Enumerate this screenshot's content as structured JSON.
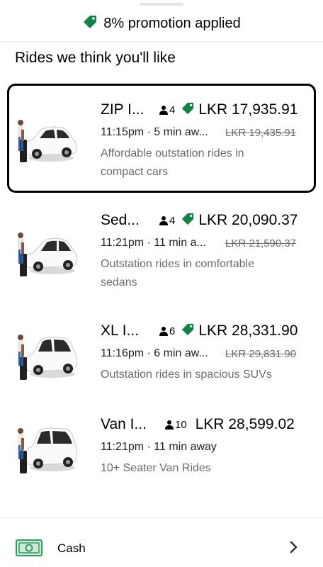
{
  "promo": {
    "text": "8% promotion applied",
    "icon": "tag-icon",
    "color": "#0e8345"
  },
  "section": {
    "title": "Rides we think you'll like"
  },
  "rides": [
    {
      "name": "ZIP I...",
      "capacity": "4",
      "promo_applied": true,
      "price": "LKR 17,935.91",
      "eta": "11:15pm · 5 min aw...",
      "old_price": "LKR 19,435.91",
      "description": "Affordable outstation rides in compact cars",
      "selected": true,
      "vehicle": "compact-car"
    },
    {
      "name": "Sed...",
      "capacity": "4",
      "promo_applied": true,
      "price": "LKR 20,090.37",
      "eta": "11:21pm · 11 min a...",
      "old_price": "LKR 21,590.37",
      "description": "Outstation rides in comfortable sedans",
      "selected": false,
      "vehicle": "sedan"
    },
    {
      "name": "XL I...",
      "capacity": "6",
      "promo_applied": true,
      "price": "LKR 28,331.90",
      "eta": "11:16pm · 6 min aw...",
      "old_price": "LKR 29,831.90",
      "description": "Outstation rides in spacious SUVs",
      "selected": false,
      "vehicle": "suv"
    },
    {
      "name": "Van I...",
      "capacity": "10",
      "promo_applied": false,
      "price": "LKR 28,599.02",
      "eta": "11:21pm · 11 min away",
      "old_price": "",
      "description": "10+ Seater Van Rides",
      "selected": false,
      "vehicle": "van"
    }
  ],
  "payment": {
    "label": "Cash",
    "icon": "cash-icon",
    "chevron": "chevron-right-icon",
    "icon_color": "#2e9e5b"
  }
}
